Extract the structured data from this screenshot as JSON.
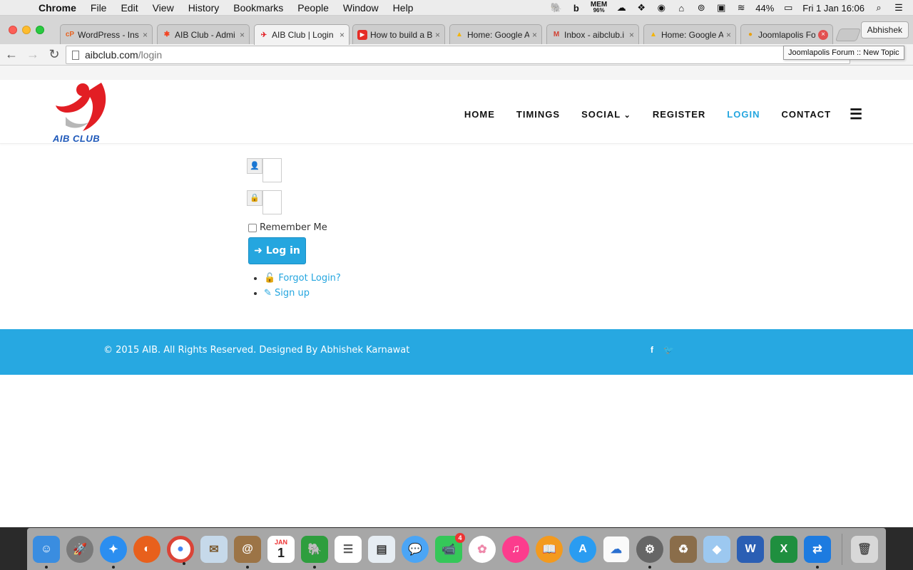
{
  "menubar": {
    "app_name": "Chrome",
    "items": [
      "File",
      "Edit",
      "View",
      "History",
      "Bookmarks",
      "People",
      "Window",
      "Help"
    ],
    "mem_label": "MEM",
    "mem_value": "96%",
    "battery": "44%",
    "clock": "Fri 1 Jan  16:06"
  },
  "browser": {
    "tabs": [
      {
        "title": "WordPress - Ins",
        "icon": "cpanel-icon"
      },
      {
        "title": "AIB Club - Admi",
        "icon": "joomla-icon"
      },
      {
        "title": "AIB Club | Login",
        "icon": "aib-icon"
      },
      {
        "title": "How to build a B",
        "icon": "youtube-icon"
      },
      {
        "title": "Home: Google A",
        "icon": "adsense-icon"
      },
      {
        "title": "Inbox - aibclub.i",
        "icon": "gmail-icon"
      },
      {
        "title": "Home: Google A",
        "icon": "adsense-icon"
      },
      {
        "title": "Joomlapolis For",
        "icon": "joomlapolis-icon"
      }
    ],
    "profile": "Abhishek",
    "url_host": "aibclub.com",
    "url_path": "/login",
    "tooltip": "Joomlapolis Forum :: New Topic"
  },
  "site": {
    "logo_text": "AIB CLUB",
    "nav": [
      "HOME",
      "TIMINGS",
      "SOCIAL",
      "REGISTER",
      "LOGIN",
      "CONTACT"
    ],
    "social_caret": "⌄",
    "remember_label": "Remember Me",
    "login_button": "Log in",
    "forgot_link": "Forgot Login?",
    "signup_link": "Sign up",
    "footer_text": "© 2015 AIB. All Rights Reserved. Designed By Abhishek Karnawat",
    "accent_color": "#25a6df"
  },
  "dock": {
    "badge_facetime": "4",
    "calendar_month": "JAN",
    "calendar_day": "1"
  }
}
